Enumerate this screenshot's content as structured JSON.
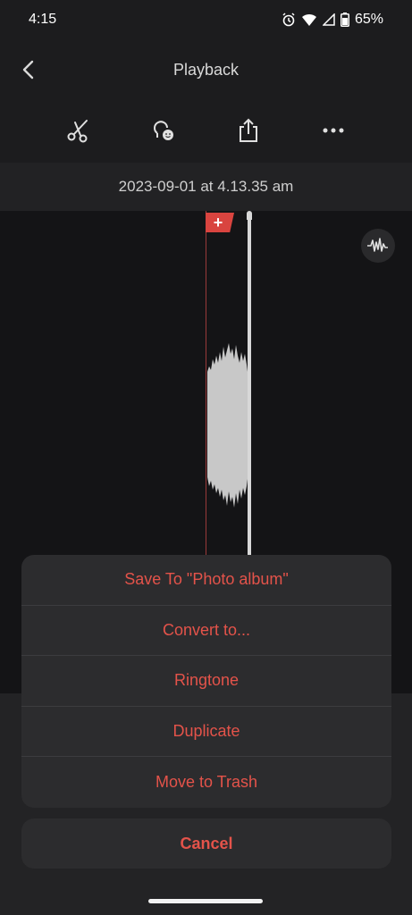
{
  "status": {
    "time": "4:15",
    "battery": "65%",
    "battery_level": 0.65,
    "icons": [
      "alarm-icon",
      "wifi-icon",
      "signal-icon",
      "battery-icon"
    ]
  },
  "header": {
    "title": "Playback",
    "back_icon": "chevron-left-icon"
  },
  "toolbar": {
    "tools": [
      "scissors-icon",
      "voice-effect-icon",
      "share-icon",
      "more-icon"
    ]
  },
  "recording": {
    "date": "2023-09-01 at 4.13.35 am",
    "marker_label": "+"
  },
  "action_sheet": {
    "items": [
      "Save To \"Photo album\"",
      "Convert to...",
      "Ringtone",
      "Duplicate",
      "Move to Trash"
    ],
    "cancel": "Cancel"
  },
  "colors": {
    "accent": "#e4534a",
    "marker": "#d9443f",
    "background": "#1c1c1e"
  }
}
